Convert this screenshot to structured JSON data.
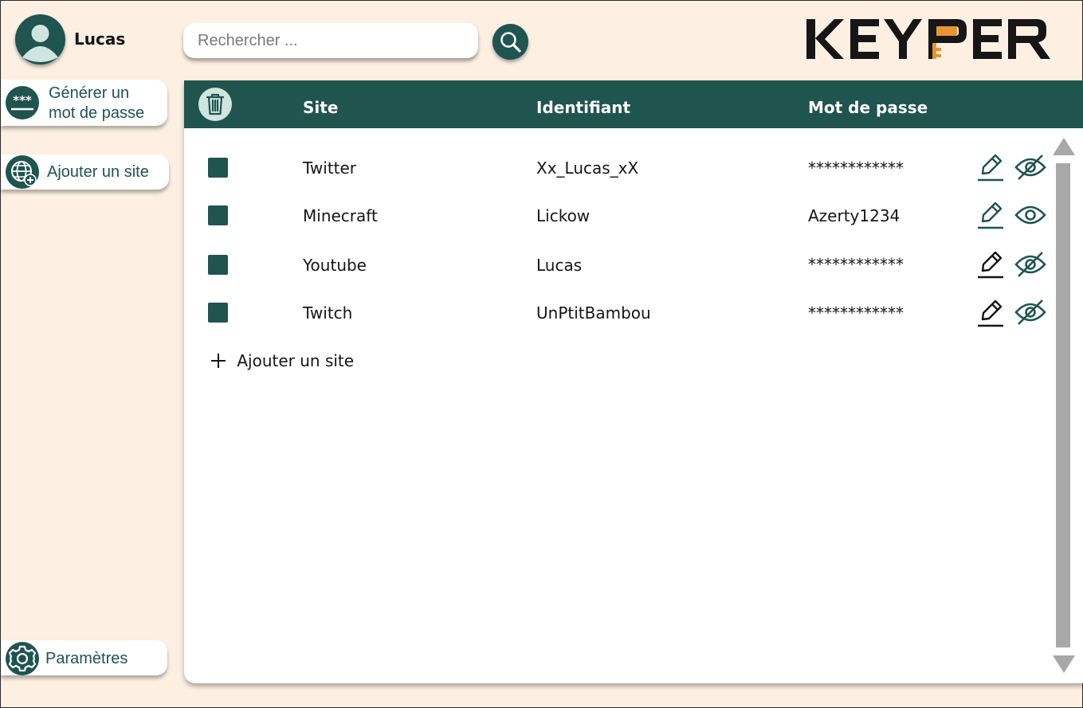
{
  "user": {
    "name": "Lucas",
    "avatar_icon": "user-avatar-icon"
  },
  "search": {
    "placeholder": "Rechercher ...",
    "value": "",
    "button_icon": "search-icon"
  },
  "logo": {
    "text": "KEYPER",
    "accent_color": "#e8952f"
  },
  "sidebar": {
    "generate_password": {
      "label_line1": "Générer un",
      "label_line2": "mot de passe",
      "icon": "password-stars-icon"
    },
    "add_site": {
      "label": "Ajouter un site",
      "icon": "globe-plus-icon"
    },
    "settings": {
      "label": "Paramètres",
      "icon": "gear-icon"
    }
  },
  "table": {
    "headers": {
      "site": "Site",
      "identifier": "Identifiant",
      "password": "Mot de passe"
    },
    "rows": [
      {
        "site": "Twitter",
        "identifier": "Xx_Lucas_xX",
        "password": "************",
        "visible": false
      },
      {
        "site": "Minecraft",
        "identifier": "Lickow",
        "password": "Azerty1234",
        "visible": true
      },
      {
        "site": "Youtube",
        "identifier": "Lucas",
        "password": "************",
        "visible": false
      },
      {
        "site": "Twitch",
        "identifier": "UnPtitBambou",
        "password": "************",
        "visible": false
      }
    ],
    "add_label": "Ajouter un site"
  },
  "colors": {
    "primary": "#1f544f",
    "background": "#fdf0e2",
    "scrollbar": "#a8a8a8"
  }
}
